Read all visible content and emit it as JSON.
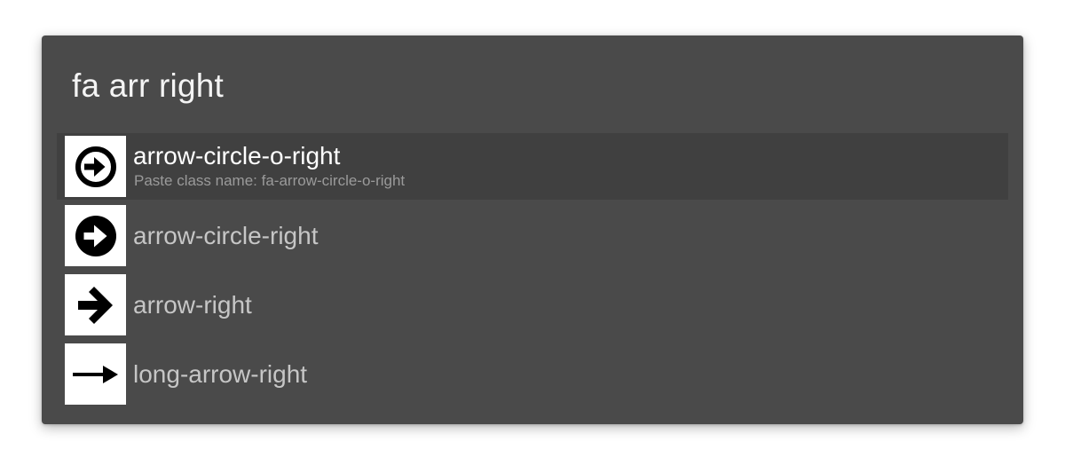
{
  "search": {
    "query": "fa arr right"
  },
  "results": [
    {
      "title": "arrow-circle-o-right",
      "subtitle": "Paste class name: fa-arrow-circle-o-right",
      "icon": "arrow-circle-o-right-icon",
      "selected": true
    },
    {
      "title": "arrow-circle-right",
      "icon": "arrow-circle-right-icon",
      "selected": false
    },
    {
      "title": "arrow-right",
      "icon": "arrow-right-icon",
      "selected": false
    },
    {
      "title": "long-arrow-right",
      "icon": "long-arrow-right-icon",
      "selected": false
    }
  ],
  "colors": {
    "panel_background": "#4a4a4a",
    "selected_row_background": "#404040",
    "query_text": "#f4f4f4",
    "selected_title_text": "#ffffff",
    "title_text": "#c6c6c6",
    "subtitle_text": "#9a9a9a",
    "icon_tile": "#ffffff"
  }
}
